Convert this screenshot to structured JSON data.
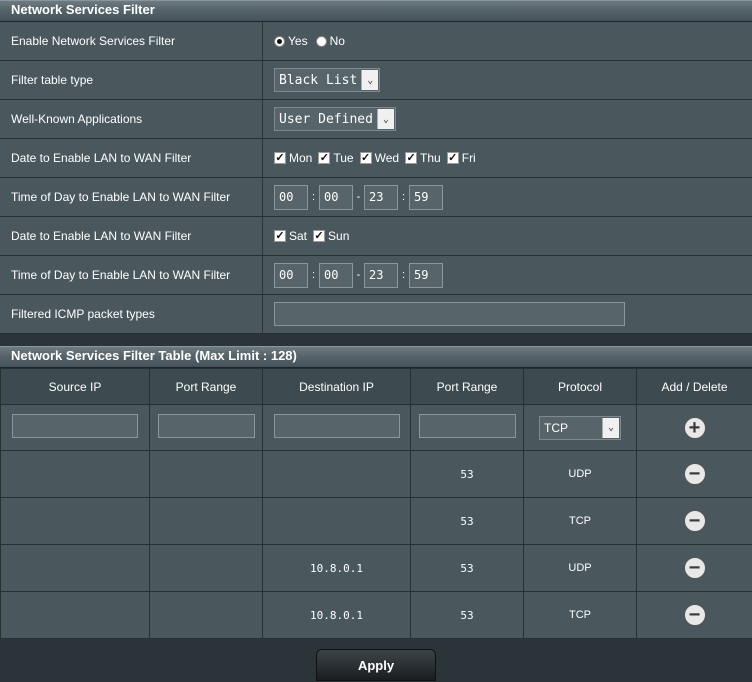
{
  "section1": {
    "title": "Network Services Filter"
  },
  "settings": {
    "enable": {
      "label": "Enable Network Services Filter",
      "yes": "Yes",
      "no": "No",
      "selected": "Yes"
    },
    "filter_type": {
      "label": "Filter table type",
      "value": "Black List"
    },
    "apps": {
      "label": "Well-Known Applications",
      "value": "User Defined"
    },
    "weekday": {
      "label": "Date to Enable LAN to WAN Filter",
      "days": [
        "Mon",
        "Tue",
        "Wed",
        "Thu",
        "Fri"
      ]
    },
    "weekday_time": {
      "label": "Time of Day to Enable LAN to WAN Filter",
      "start_h": "00",
      "start_m": "00",
      "end_h": "23",
      "end_m": "59"
    },
    "weekend": {
      "label": "Date to Enable LAN to WAN Filter",
      "days": [
        "Sat",
        "Sun"
      ]
    },
    "weekend_time": {
      "label": "Time of Day to Enable LAN to WAN Filter",
      "start_h": "00",
      "start_m": "00",
      "end_h": "23",
      "end_m": "59"
    },
    "icmp": {
      "label": "Filtered ICMP packet types",
      "value": ""
    }
  },
  "section2": {
    "title": "Network Services Filter Table (Max Limit : 128)"
  },
  "table": {
    "headers": [
      "Source IP",
      "Port Range",
      "Destination IP",
      "Port Range",
      "Protocol",
      "Add / Delete"
    ],
    "new_protocol": "TCP",
    "rows": [
      [
        "",
        "",
        "",
        "53",
        "UDP"
      ],
      [
        "",
        "",
        "",
        "53",
        "TCP"
      ],
      [
        "",
        "",
        "10.8.0.1",
        "53",
        "UDP"
      ],
      [
        "",
        "",
        "10.8.0.1",
        "53",
        "TCP"
      ]
    ]
  },
  "apply_label": "Apply",
  "icons": {
    "add": "plus-circle-icon",
    "delete": "minus-circle-icon",
    "dropdown": "chevron-down-icon"
  }
}
